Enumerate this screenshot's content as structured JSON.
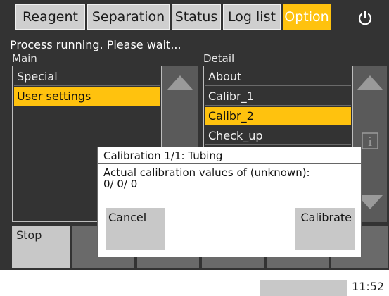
{
  "tabs": [
    {
      "label": "Reagent",
      "active": false
    },
    {
      "label": "Separation",
      "active": false
    },
    {
      "label": "Status",
      "active": false
    },
    {
      "label": "Log list",
      "active": false
    },
    {
      "label": "Option",
      "active": true
    }
  ],
  "power_icon": "power-icon",
  "status_text": "Process running. Please wait...",
  "main": {
    "label": "Main",
    "items": [
      "Special",
      "User settings"
    ],
    "selected": "User settings"
  },
  "detail": {
    "label": "Detail",
    "items": [
      "About",
      "Calibr_1",
      "Calibr_2",
      "Check_up"
    ],
    "selected": "Calibr_2"
  },
  "stop_label": "Stop",
  "dialog": {
    "title": "Calibration 1/1: Tubing",
    "message_line1": "Actual calibration values of (unknown):",
    "message_line2": "0/ 0/ 0",
    "cancel_label": "Cancel",
    "calibrate_label": "Calibrate"
  },
  "clock": "11:52",
  "colors": {
    "accent": "#ffc20e",
    "background": "#333333"
  }
}
